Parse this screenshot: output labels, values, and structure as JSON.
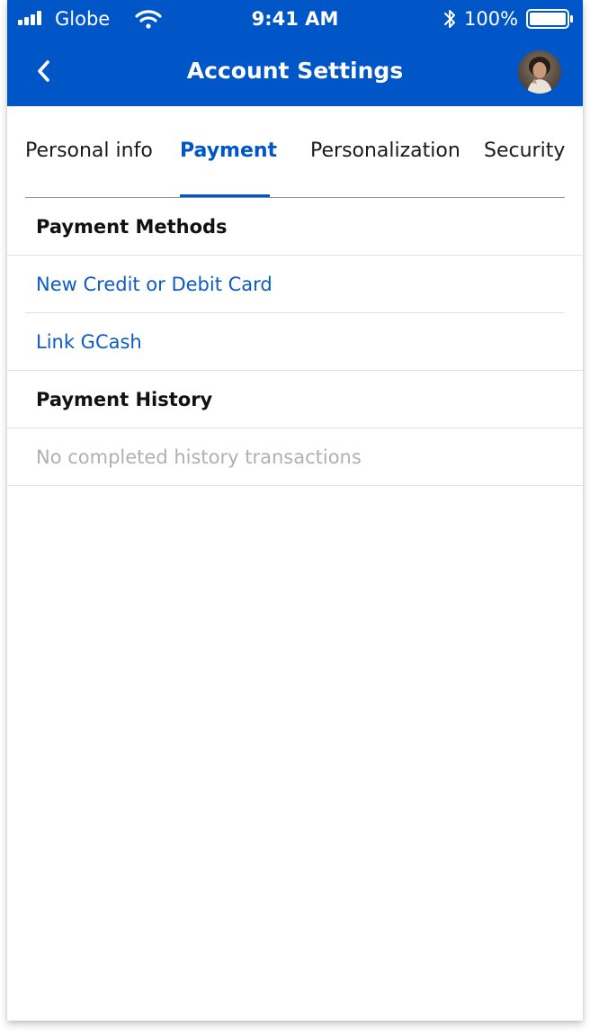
{
  "status_bar": {
    "carrier": "Globe",
    "time": "9:41 AM",
    "battery_percent": "100%"
  },
  "header": {
    "title": "Account Settings"
  },
  "tabs": [
    {
      "label": "Personal info",
      "active": false
    },
    {
      "label": "Payment",
      "active": true
    },
    {
      "label": "Personalization",
      "active": false
    },
    {
      "label": "Security",
      "active": false
    }
  ],
  "payment_methods": {
    "title": "Payment Methods",
    "items": [
      {
        "label": "New Credit or Debit Card"
      },
      {
        "label": "Link GCash"
      }
    ]
  },
  "payment_history": {
    "title": "Payment History",
    "empty_text": "No completed history transactions"
  },
  "colors": {
    "brand_blue": "#0056c7",
    "link_blue": "#0c5cc4",
    "muted_gray": "#b0b0b0"
  },
  "icons": {
    "signal": "signal-icon",
    "wifi": "wifi-icon",
    "bluetooth": "bluetooth-icon",
    "battery": "battery-icon",
    "back": "back-arrow-icon",
    "avatar": "avatar"
  }
}
